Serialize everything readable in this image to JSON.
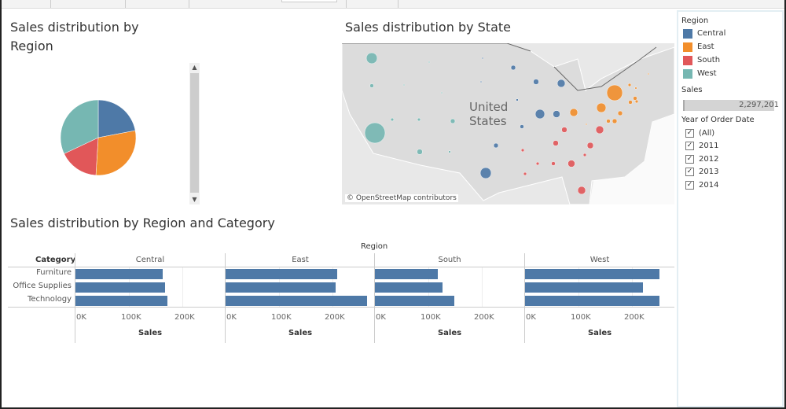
{
  "pie_panel": {
    "title": "Sales distribution by Region"
  },
  "map_panel": {
    "title": "Sales distribution by State",
    "country_label_1": "United",
    "country_label_2": "States",
    "attribution": "© OpenStreetMap contributors"
  },
  "bar_panel": {
    "title": "Sales distribution by Region and Category",
    "column_header": "Region",
    "row_header": "Category",
    "axis_title": "Sales",
    "axis_ticks": [
      "0K",
      "100K",
      "200K"
    ]
  },
  "colors": {
    "Central": "#4e79a7",
    "East": "#f28e2b",
    "South": "#e15759",
    "West": "#76b7b2"
  },
  "legend": {
    "region_title": "Region",
    "regions": [
      {
        "label": "Central",
        "color": "#4e79a7"
      },
      {
        "label": "East",
        "color": "#f28e2b"
      },
      {
        "label": "South",
        "color": "#e15759"
      },
      {
        "label": "West",
        "color": "#76b7b2"
      }
    ],
    "sales_title": "Sales",
    "sales_value": "2,297,201",
    "year_title": "Year of Order Date",
    "years": [
      {
        "label": "(All)",
        "checked": true
      },
      {
        "label": "2011",
        "checked": true
      },
      {
        "label": "2012",
        "checked": true
      },
      {
        "label": "2013",
        "checked": true
      },
      {
        "label": "2014",
        "checked": true
      }
    ]
  },
  "chart_data": [
    {
      "type": "pie",
      "title": "Sales distribution by Region",
      "categories": [
        "Central",
        "East",
        "South",
        "West"
      ],
      "values": [
        22,
        29,
        17,
        32
      ]
    },
    {
      "type": "bar",
      "title": "Sales distribution by Region and Category",
      "orientation": "horizontal",
      "xlabel": "Sales",
      "xlim": [
        0,
        270000
      ],
      "panels": [
        "Central",
        "East",
        "South",
        "West"
      ],
      "categories": [
        "Furniture",
        "Office Supplies",
        "Technology"
      ],
      "series": [
        {
          "panel": "Central",
          "values": [
            163000,
            167000,
            172000
          ]
        },
        {
          "panel": "East",
          "values": [
            209000,
            206000,
            265000
          ]
        },
        {
          "panel": "South",
          "values": [
            118000,
            126000,
            149000
          ]
        },
        {
          "panel": "West",
          "values": [
            252000,
            221000,
            252000
          ]
        }
      ]
    }
  ]
}
